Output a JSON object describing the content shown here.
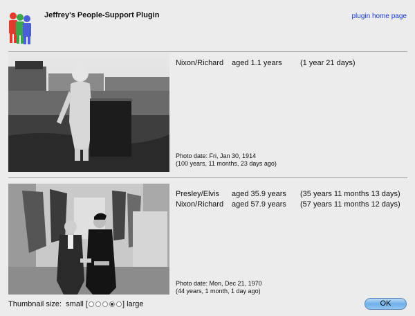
{
  "header": {
    "title": "Jeffrey's People-Support Plugin",
    "home_link": "plugin home page",
    "logo_icon": "people-group-icon",
    "logo_colors": [
      "#e23b2e",
      "#3aa84a",
      "#4a5ed8"
    ]
  },
  "photos": [
    {
      "people": [
        {
          "name": "Nixon/Richard",
          "age": "aged 1.1 years",
          "age_detail": "(1 year 21 days)"
        }
      ],
      "photo_date": "Photo date: Fri, Jan 30, 1914",
      "photo_ago": "(100 years, 11 months, 23 days ago)"
    },
    {
      "people": [
        {
          "name": "Presley/Elvis",
          "age": "aged 35.9 years",
          "age_detail": "(35 years 11 months 13 days)"
        },
        {
          "name": "Nixon/Richard",
          "age": "aged 57.9 years",
          "age_detail": "(57 years 11 months 12 days)"
        }
      ],
      "photo_date": "Photo date: Mon, Dec 21, 1970",
      "photo_ago": "(44 years, 1 month, 1 day ago)"
    }
  ],
  "footer": {
    "thumbnail_label": "Thumbnail size:",
    "small_label": "small [",
    "large_label": "] large",
    "sizes": 5,
    "selected_index": 3,
    "ok_label": "OK"
  }
}
